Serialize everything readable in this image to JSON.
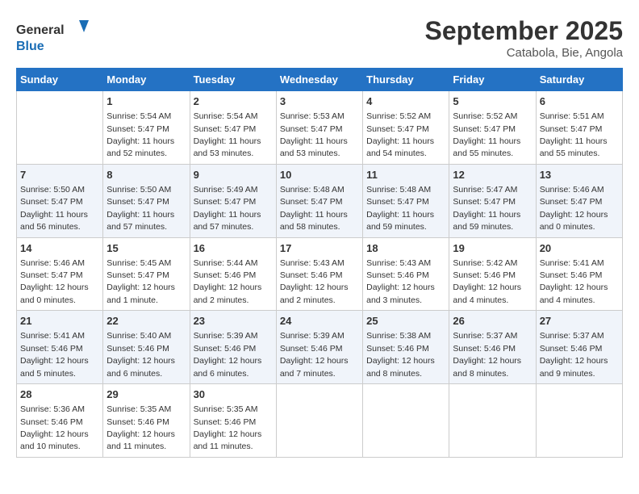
{
  "logo": {
    "line1": "General",
    "line2": "Blue"
  },
  "title": "September 2025",
  "subtitle": "Catabola, Bie, Angola",
  "days_header": [
    "Sunday",
    "Monday",
    "Tuesday",
    "Wednesday",
    "Thursday",
    "Friday",
    "Saturday"
  ],
  "weeks": [
    [
      {
        "day": "",
        "info": ""
      },
      {
        "day": "1",
        "info": "Sunrise: 5:54 AM\nSunset: 5:47 PM\nDaylight: 11 hours\nand 52 minutes."
      },
      {
        "day": "2",
        "info": "Sunrise: 5:54 AM\nSunset: 5:47 PM\nDaylight: 11 hours\nand 53 minutes."
      },
      {
        "day": "3",
        "info": "Sunrise: 5:53 AM\nSunset: 5:47 PM\nDaylight: 11 hours\nand 53 minutes."
      },
      {
        "day": "4",
        "info": "Sunrise: 5:52 AM\nSunset: 5:47 PM\nDaylight: 11 hours\nand 54 minutes."
      },
      {
        "day": "5",
        "info": "Sunrise: 5:52 AM\nSunset: 5:47 PM\nDaylight: 11 hours\nand 55 minutes."
      },
      {
        "day": "6",
        "info": "Sunrise: 5:51 AM\nSunset: 5:47 PM\nDaylight: 11 hours\nand 55 minutes."
      }
    ],
    [
      {
        "day": "7",
        "info": "Sunrise: 5:50 AM\nSunset: 5:47 PM\nDaylight: 11 hours\nand 56 minutes."
      },
      {
        "day": "8",
        "info": "Sunrise: 5:50 AM\nSunset: 5:47 PM\nDaylight: 11 hours\nand 57 minutes."
      },
      {
        "day": "9",
        "info": "Sunrise: 5:49 AM\nSunset: 5:47 PM\nDaylight: 11 hours\nand 57 minutes."
      },
      {
        "day": "10",
        "info": "Sunrise: 5:48 AM\nSunset: 5:47 PM\nDaylight: 11 hours\nand 58 minutes."
      },
      {
        "day": "11",
        "info": "Sunrise: 5:48 AM\nSunset: 5:47 PM\nDaylight: 11 hours\nand 59 minutes."
      },
      {
        "day": "12",
        "info": "Sunrise: 5:47 AM\nSunset: 5:47 PM\nDaylight: 11 hours\nand 59 minutes."
      },
      {
        "day": "13",
        "info": "Sunrise: 5:46 AM\nSunset: 5:47 PM\nDaylight: 12 hours\nand 0 minutes."
      }
    ],
    [
      {
        "day": "14",
        "info": "Sunrise: 5:46 AM\nSunset: 5:47 PM\nDaylight: 12 hours\nand 0 minutes."
      },
      {
        "day": "15",
        "info": "Sunrise: 5:45 AM\nSunset: 5:47 PM\nDaylight: 12 hours\nand 1 minute."
      },
      {
        "day": "16",
        "info": "Sunrise: 5:44 AM\nSunset: 5:46 PM\nDaylight: 12 hours\nand 2 minutes."
      },
      {
        "day": "17",
        "info": "Sunrise: 5:43 AM\nSunset: 5:46 PM\nDaylight: 12 hours\nand 2 minutes."
      },
      {
        "day": "18",
        "info": "Sunrise: 5:43 AM\nSunset: 5:46 PM\nDaylight: 12 hours\nand 3 minutes."
      },
      {
        "day": "19",
        "info": "Sunrise: 5:42 AM\nSunset: 5:46 PM\nDaylight: 12 hours\nand 4 minutes."
      },
      {
        "day": "20",
        "info": "Sunrise: 5:41 AM\nSunset: 5:46 PM\nDaylight: 12 hours\nand 4 minutes."
      }
    ],
    [
      {
        "day": "21",
        "info": "Sunrise: 5:41 AM\nSunset: 5:46 PM\nDaylight: 12 hours\nand 5 minutes."
      },
      {
        "day": "22",
        "info": "Sunrise: 5:40 AM\nSunset: 5:46 PM\nDaylight: 12 hours\nand 6 minutes."
      },
      {
        "day": "23",
        "info": "Sunrise: 5:39 AM\nSunset: 5:46 PM\nDaylight: 12 hours\nand 6 minutes."
      },
      {
        "day": "24",
        "info": "Sunrise: 5:39 AM\nSunset: 5:46 PM\nDaylight: 12 hours\nand 7 minutes."
      },
      {
        "day": "25",
        "info": "Sunrise: 5:38 AM\nSunset: 5:46 PM\nDaylight: 12 hours\nand 8 minutes."
      },
      {
        "day": "26",
        "info": "Sunrise: 5:37 AM\nSunset: 5:46 PM\nDaylight: 12 hours\nand 8 minutes."
      },
      {
        "day": "27",
        "info": "Sunrise: 5:37 AM\nSunset: 5:46 PM\nDaylight: 12 hours\nand 9 minutes."
      }
    ],
    [
      {
        "day": "28",
        "info": "Sunrise: 5:36 AM\nSunset: 5:46 PM\nDaylight: 12 hours\nand 10 minutes."
      },
      {
        "day": "29",
        "info": "Sunrise: 5:35 AM\nSunset: 5:46 PM\nDaylight: 12 hours\nand 11 minutes."
      },
      {
        "day": "30",
        "info": "Sunrise: 5:35 AM\nSunset: 5:46 PM\nDaylight: 12 hours\nand 11 minutes."
      },
      {
        "day": "",
        "info": ""
      },
      {
        "day": "",
        "info": ""
      },
      {
        "day": "",
        "info": ""
      },
      {
        "day": "",
        "info": ""
      }
    ]
  ]
}
